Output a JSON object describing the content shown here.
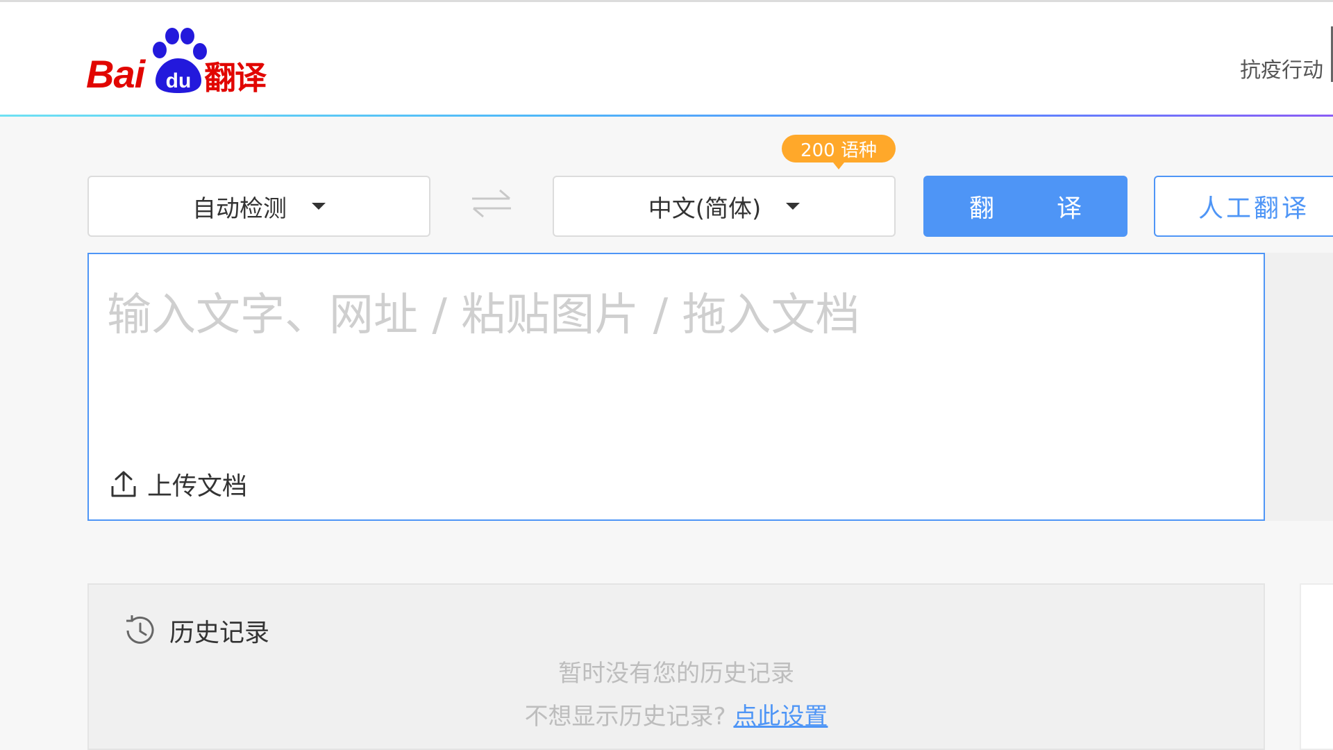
{
  "header": {
    "logo": {
      "bai": "Bai",
      "du": "du",
      "fanyi": "翻译"
    },
    "link": "抗疫行动"
  },
  "toolbar": {
    "source_lang": "自动检测",
    "target_lang": "中文(简体)",
    "lang_badge": "200 语种",
    "translate_label": "翻 译",
    "human_translate_label": "人工翻译"
  },
  "input": {
    "placeholder": "输入文字、网址 / 粘贴图片 / 拖入文档",
    "upload_label": "上传文档"
  },
  "history": {
    "title": "历史记录",
    "empty_text": "暂时没有您的历史记录",
    "hide_prompt": "不想显示历史记录?",
    "settings_link": "点此设置"
  },
  "colors": {
    "brand_red": "#e10601",
    "brand_blue": "#2319dc",
    "accent_blue": "#4e95f6",
    "badge_orange": "#ffa82a"
  }
}
